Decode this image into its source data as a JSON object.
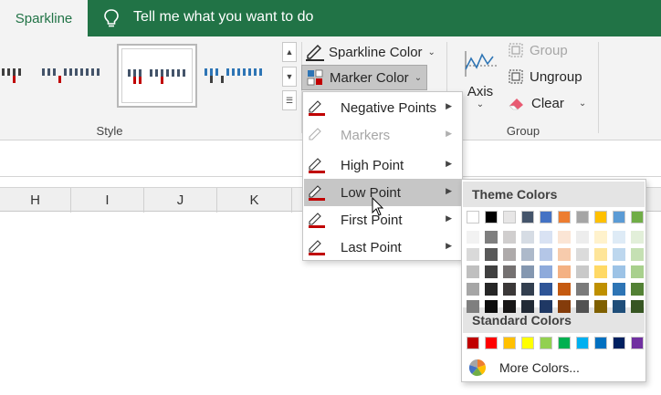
{
  "tabs": {
    "active": "Sparkline",
    "tell_me": "Tell me what you want to do"
  },
  "ribbon": {
    "style_group_label": "Style",
    "sparkline_color": "Sparkline Color",
    "marker_color": "Marker Color",
    "axis": "Axis",
    "group": "Group",
    "ungroup": "Ungroup",
    "clear": "Clear",
    "group_group_label": "Group"
  },
  "columns": [
    "H",
    "I",
    "J",
    "K"
  ],
  "marker_menu": {
    "items": [
      {
        "label": "Negative Points",
        "state": "normal"
      },
      {
        "label": "Markers",
        "state": "disabled"
      },
      {
        "label": "High Point",
        "state": "normal"
      },
      {
        "label": "Low Point",
        "state": "hover"
      },
      {
        "label": "First Point",
        "state": "normal"
      },
      {
        "label": "Last Point",
        "state": "normal"
      }
    ]
  },
  "color_panel": {
    "theme_title": "Theme Colors",
    "standard_title": "Standard Colors",
    "more_colors": "More Colors...",
    "theme_colors": [
      "#ffffff",
      "#000000",
      "#e7e6e6",
      "#44546a",
      "#4472c4",
      "#ed7d31",
      "#a5a5a5",
      "#ffc000",
      "#5b9bd5",
      "#70ad47"
    ],
    "theme_shades": [
      [
        "#f2f2f2",
        "#d9d9d9",
        "#bfbfbf",
        "#a6a6a6",
        "#7f7f7f"
      ],
      [
        "#7f7f7f",
        "#595959",
        "#404040",
        "#262626",
        "#0d0d0d"
      ],
      [
        "#d0cece",
        "#aeaaaa",
        "#757171",
        "#3b3838",
        "#171616"
      ],
      [
        "#d6dce4",
        "#adb9ca",
        "#8497b0",
        "#333f4f",
        "#222a35"
      ],
      [
        "#d9e2f3",
        "#b4c6e7",
        "#8eaadb",
        "#2f5597",
        "#1f3864"
      ],
      [
        "#fbe5d5",
        "#f7cbac",
        "#f4b183",
        "#c55a11",
        "#843c0b"
      ],
      [
        "#ededed",
        "#dbdbdb",
        "#c9c9c9",
        "#7b7b7b",
        "#525252"
      ],
      [
        "#fff2cc",
        "#fee599",
        "#ffd965",
        "#bf9000",
        "#7f6000"
      ],
      [
        "#deebf6",
        "#bdd7ee",
        "#9dc3e6",
        "#2e75b5",
        "#1f4e79"
      ],
      [
        "#e2efd9",
        "#c5e0b3",
        "#a8d08d",
        "#538135",
        "#375623"
      ]
    ],
    "standard_colors": [
      "#c00000",
      "#ff0000",
      "#ffc000",
      "#ffff00",
      "#92d050",
      "#00b050",
      "#00b0f0",
      "#0070c0",
      "#002060",
      "#7030a0"
    ]
  },
  "accent_colors": {
    "excel_green": "#217346",
    "marker_red": "#c00000",
    "menu_hover": "#c6c6c6"
  }
}
